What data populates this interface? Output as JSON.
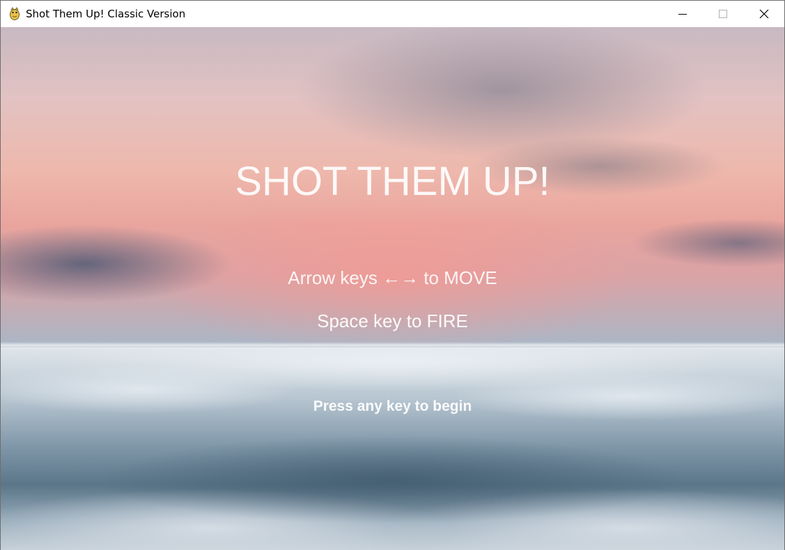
{
  "window": {
    "title": "Shot Them Up! Classic Version",
    "icon": "python-snake-icon",
    "controls": [
      "minimize-icon",
      "maximize-icon",
      "close-icon"
    ]
  },
  "game": {
    "title": "SHOT THEM UP!",
    "instructions": {
      "move": "Arrow keys ←→ to MOVE",
      "fire": "Space key to FIRE"
    },
    "prompt": "Press any key to begin"
  },
  "colors": {
    "text": "#ffffff",
    "sky_top": "#c8b9c2",
    "sky_glow": "#e9a49e",
    "cloud_deep": "#5b7689"
  }
}
